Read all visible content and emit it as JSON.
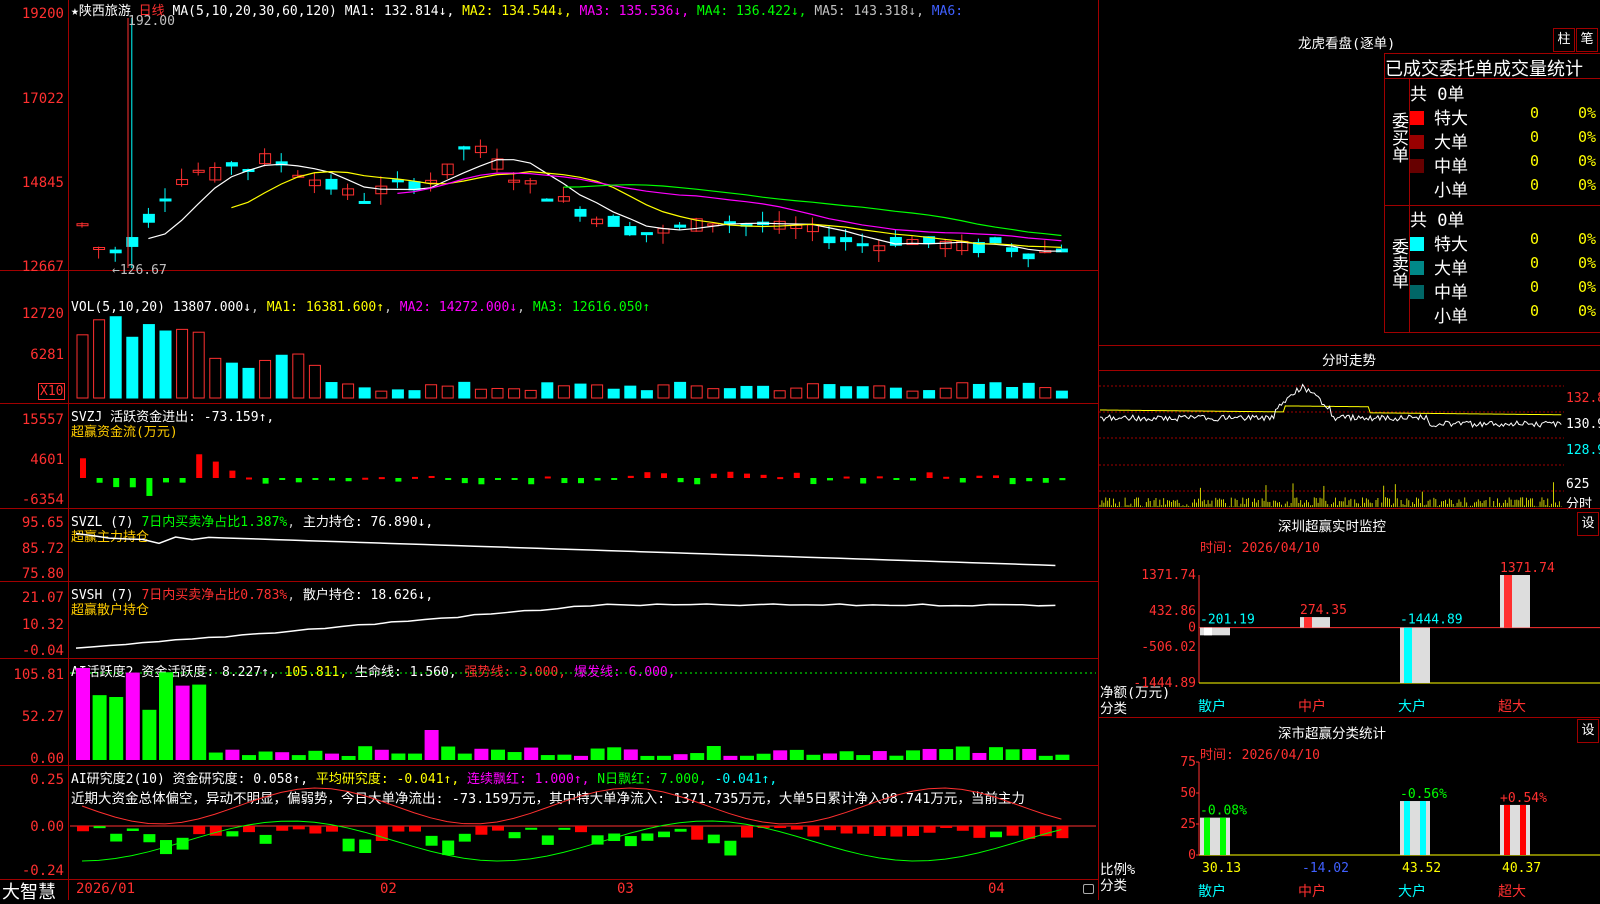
{
  "app": {
    "brand": "大智慧"
  },
  "main": {
    "stock_name": "★陕西旅游",
    "period_label": "日线",
    "ma_header": "MA(5,10,20,30,60,120)",
    "ma_values": [
      {
        "label": "MA1: 132.814↓",
        "color": "#ffffff"
      },
      {
        "label": "MA2: 134.544↓",
        "color": "#ffff00"
      },
      {
        "label": "MA3: 135.536↓",
        "color": "#ff00ff"
      },
      {
        "label": "MA4: 136.422↓",
        "color": "#00ff00"
      },
      {
        "label": "MA5: 143.318↓",
        "color": "#c0c0c0"
      },
      {
        "label": "MA6:",
        "color": "#4060ff"
      }
    ],
    "y_labels": [
      "19200",
      "17022",
      "14845",
      "12667"
    ],
    "high_note": "192.00",
    "low_note": "←126.67"
  },
  "volume": {
    "header": "VOL(5,10,20)",
    "current": "13807.000↓",
    "ma1": "MA1: 16381.600↑",
    "ma2": "MA2: 14272.000↓",
    "ma3": "MA3: 12616.050↑",
    "y_labels": [
      "12720",
      "6281"
    ],
    "unit": "X10"
  },
  "svzj": {
    "header": "SVZJ  活跃资金进出: -73.159↑,",
    "subtitle": "超赢资金流(万元)",
    "y_labels": [
      "15557",
      "4601",
      "-6354"
    ]
  },
  "svzl": {
    "name": "SVZL (7)",
    "ratio": "7日内买卖净占比1.387%",
    "hold": "主力持仓: 76.890↓,",
    "subtitle": "超赢主力持仓",
    "y_labels": [
      "95.65",
      "85.72",
      "75.80"
    ]
  },
  "svsh": {
    "name": "SVSH (7)",
    "ratio": "7日内买卖净占比0.783%",
    "hold": "散户持仓: 18.626↓,",
    "subtitle": "超赢散户持仓",
    "y_labels": [
      "21.07",
      "10.32",
      "-0.04"
    ]
  },
  "ai_active": {
    "name": "AI活跃度2",
    "v1": "资金活跃度: 8.227↑,",
    "v2": "105.811,",
    "v3": "生命线: 1.560,",
    "v4": "强势线: 3.000,",
    "v5": "爆发线: 6.000,",
    "y_labels": [
      "105.81",
      "52.27",
      "0.00"
    ]
  },
  "ai_research": {
    "name": "AI研究度2(10)",
    "v1": "资金研究度: 0.058↑,",
    "v2": "平均研究度: -0.041↑,",
    "v3": "连续飘红: 1.000↑,",
    "v4": "N日飘红: 7.000,",
    "v5": "-0.041↑,",
    "summary": "近期大资金总体偏空，异动不明显，偏弱势，今日大单净流出: -73.159万元，其中特大单净流入: 1371.735万元，大单5日累计净入98.741万元，当前主力",
    "y_labels": [
      "0.25",
      "0.00",
      "-0.24"
    ]
  },
  "date_axis": [
    "2026/01",
    "02",
    "03",
    "04"
  ],
  "longhu": {
    "title": "龙虎看盘(逐单)",
    "btn1": "柱",
    "btn2": "笔",
    "subtitle": "已成交委托单成交量统计",
    "buy_total": "共 0单",
    "buy_label": "委买单",
    "sell_total": "共 0单",
    "sell_label": "委卖单",
    "buy_rows": [
      {
        "label": "特大",
        "val": "0",
        "pct": "0%",
        "color": "#ff0000"
      },
      {
        "label": "大单",
        "val": "0",
        "pct": "0%",
        "color": "#990000"
      },
      {
        "label": "中单",
        "val": "0",
        "pct": "0%",
        "color": "#660000"
      },
      {
        "label": "小单",
        "val": "0",
        "pct": "0%",
        "color": ""
      }
    ],
    "sell_rows": [
      {
        "label": "特大",
        "val": "0",
        "pct": "0%",
        "color": "#00ffff"
      },
      {
        "label": "大单",
        "val": "0",
        "pct": "0%",
        "color": "#008888"
      },
      {
        "label": "中单",
        "val": "0",
        "pct": "0%",
        "color": "#006666"
      },
      {
        "label": "小单",
        "val": "0",
        "pct": "0%",
        "color": ""
      }
    ]
  },
  "intraday": {
    "title": "分时走势",
    "y_labels": [
      "132.8",
      "130.9",
      "128.9",
      "625"
    ],
    "bottom_label": "分时"
  },
  "monitor": {
    "title": "深圳超赢实时监控",
    "btn": "设",
    "time": "时间: 2026/04/10",
    "y_labels": [
      "1371.74",
      "432.86",
      "0",
      "-506.02",
      "-1444.89"
    ],
    "y_axis_title": "净额(万元)",
    "x_axis_title": "分类",
    "categories": [
      "散户",
      "中户",
      "大户",
      "超大"
    ]
  },
  "classify": {
    "title": "深市超赢分类统计",
    "btn": "设",
    "time": "时间: 2026/04/10",
    "y_labels": [
      "75",
      "50",
      "25",
      "0"
    ],
    "y_axis_title": "比例%",
    "x_axis_title": "分类",
    "categories": [
      "散户",
      "中户",
      "大户",
      "超大"
    ]
  },
  "chart_data": [
    {
      "type": "bar",
      "title": "深圳超赢实时监控",
      "ylabel": "净额(万元)",
      "xlabel": "分类",
      "categories": [
        "散户",
        "中户",
        "大户",
        "超大"
      ],
      "values": [
        -201.19,
        274.35,
        -1444.89,
        1371.74
      ],
      "value_labels": [
        "-201.19",
        "274.35",
        "-1444.89",
        "1371.74"
      ],
      "ylim": [
        -1444.89,
        1371.74
      ]
    },
    {
      "type": "bar",
      "title": "深市超赢分类统计",
      "ylabel": "比例%",
      "xlabel": "分类",
      "categories": [
        "散户",
        "中户",
        "大户",
        "超大"
      ],
      "values": [
        30.13,
        -14.02,
        43.52,
        40.37
      ],
      "value_labels": [
        "30.13",
        "-14.02",
        "43.52",
        "40.37"
      ],
      "change_labels": [
        "-0.08%",
        "",
        "-0.56%",
        "+0.54%"
      ],
      "ylim": [
        0,
        75
      ]
    }
  ]
}
